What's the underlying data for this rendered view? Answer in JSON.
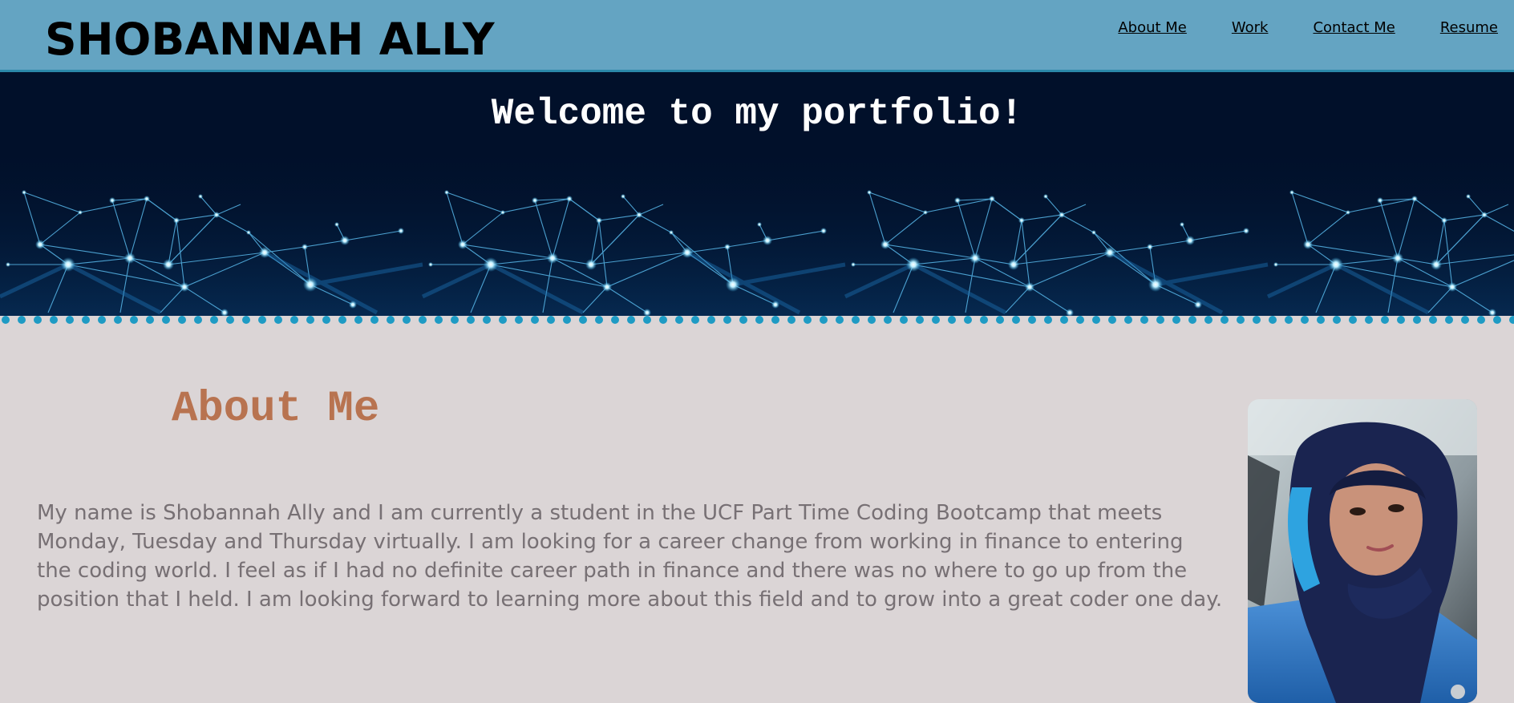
{
  "header": {
    "site_name": "SHOBANNAH ALLY",
    "nav": [
      {
        "label": "About Me"
      },
      {
        "label": "Work"
      },
      {
        "label": "Contact Me"
      },
      {
        "label": "Resume"
      }
    ]
  },
  "hero": {
    "title": "Welcome to my portfolio!"
  },
  "about": {
    "heading": "About Me",
    "body": "My name is Shobannah Ally and I am currently a student in the UCF Part Time Coding Bootcamp that meets Monday, Tuesday and Thursday virtually. I am looking for a career change from working in finance to entering the coding world. I feel as if I had no definite career path in finance and there was no where to go up from the position that I held. I am looking forward to learning more about this field and to grow into a great coder one day."
  },
  "colors": {
    "header_bg": "#64a4c2",
    "hero_bg": "#01102a",
    "page_bg": "#dbd5d6",
    "heading_accent": "#b87350",
    "body_text": "#777074",
    "dot_accent": "#1e9bc4"
  },
  "icons": {
    "hero_art": "network-graphic",
    "profile": "profile-photo"
  }
}
